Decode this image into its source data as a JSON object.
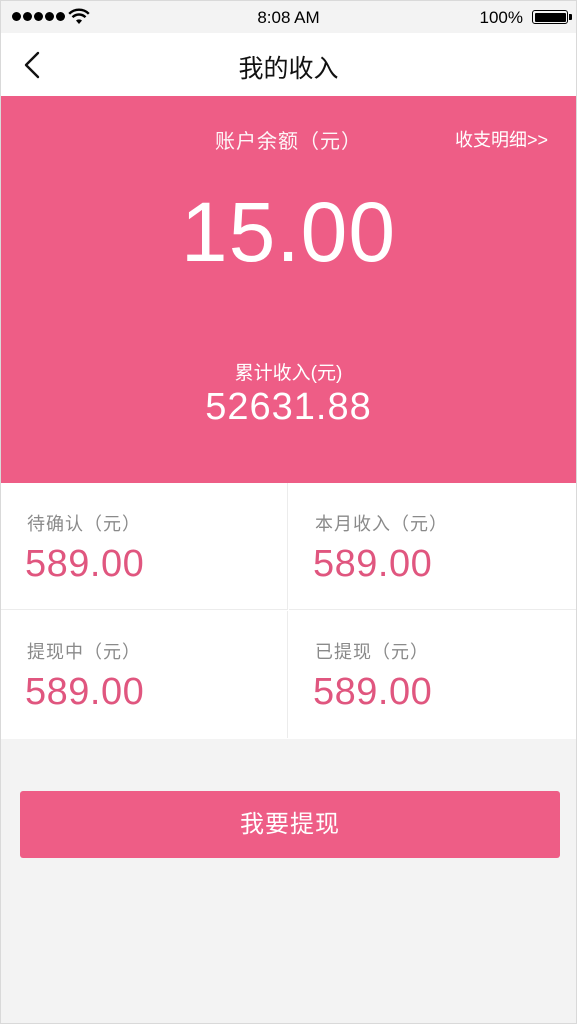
{
  "status_bar": {
    "time": "8:08 AM",
    "battery": "100%"
  },
  "nav": {
    "title": "我的收入",
    "back_icon": "chevron-left-icon"
  },
  "balance": {
    "label": "账户余额（元）",
    "detail_link": "收支明细>>",
    "amount": "15.00",
    "total_label": "累计收入(元)",
    "total_amount": "52631.88",
    "accent_color": "#ee5d86"
  },
  "stats": [
    {
      "label": "待确认（元）",
      "value": "589.00"
    },
    {
      "label": "本月收入（元）",
      "value": "589.00"
    },
    {
      "label": "提现中（元）",
      "value": "589.00"
    },
    {
      "label": "已提现（元）",
      "value": "589.00"
    }
  ],
  "withdraw_button": {
    "label": "我要提现"
  }
}
